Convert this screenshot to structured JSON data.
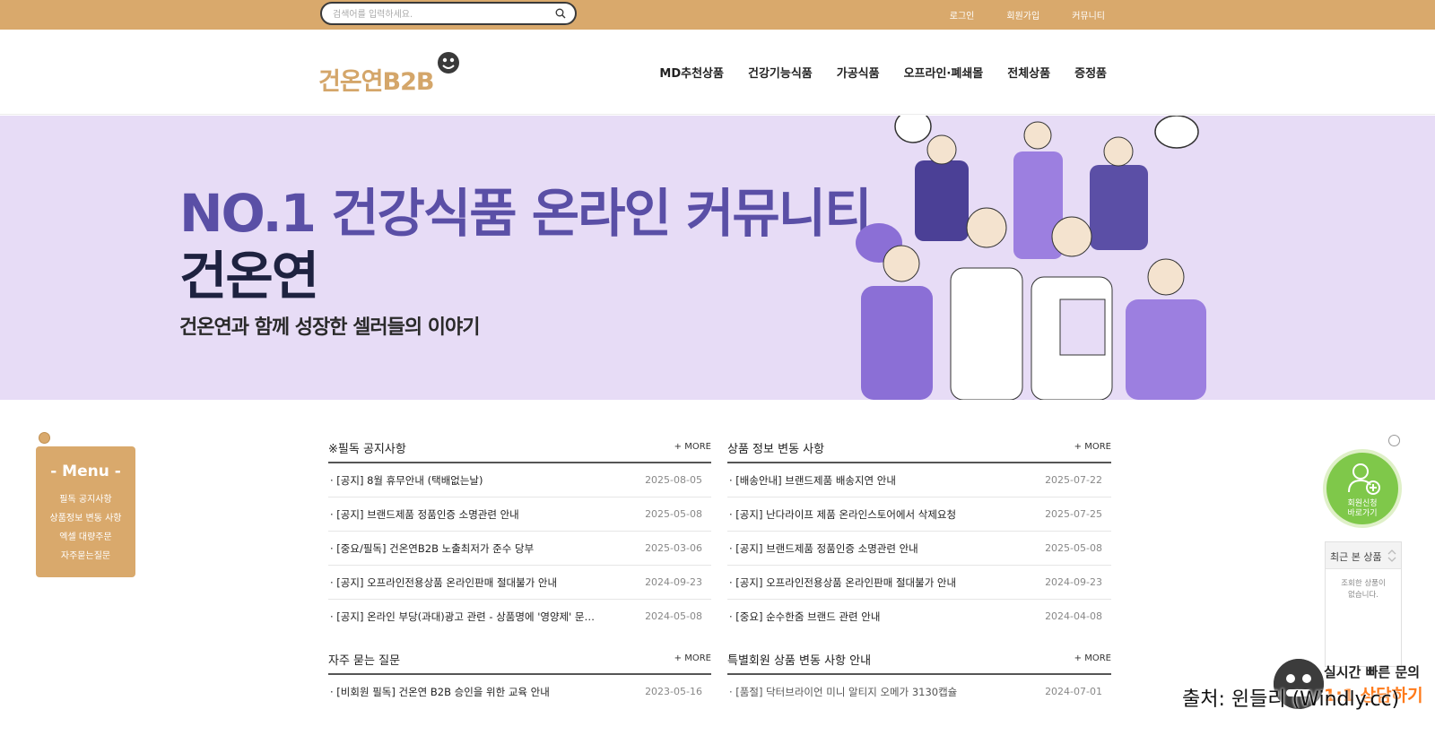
{
  "topbar": {
    "search_placeholder": "검색어를 입력하세요.",
    "links": [
      "로그인",
      "회원가입",
      "커뮤니티"
    ]
  },
  "header": {
    "logo_text": "건온연B2B",
    "nav": [
      "MD추천상품",
      "건강기능식품",
      "가공식품",
      "오프라인·폐쇄몰",
      "전체상품",
      "증정품"
    ]
  },
  "banner": {
    "title": "NO.1 건강식품 온라인 커뮤니티",
    "brand": "건온연",
    "subtitle": "건온연과 함께 성장한 셀러들의 이야기"
  },
  "float_menu": {
    "title": "- Menu -",
    "items": [
      "필독 공지사항",
      "상품정보 변동 사항",
      "엑셀 대량주문",
      "자주묻는질문"
    ]
  },
  "boards": {
    "notice": {
      "title": "※필독 공지사항",
      "more": "+ MORE",
      "rows": [
        {
          "title": "· [공지] 8월 휴무안내 (택배없는날)",
          "date": "2025-08-05"
        },
        {
          "title": "· [공지] 브랜드제품 정품인증 소명관련 안내",
          "date": "2025-05-08"
        },
        {
          "title": "· [중요/필독] 건온연B2B 노출최저가 준수 당부",
          "date": "2025-03-06"
        },
        {
          "title": "· [공지] 오프라인전용상품 온라인판매 절대불가 안내",
          "date": "2024-09-23"
        },
        {
          "title": "· [공지] 온라인 부당(과대)광고 관련 - 상품명에 '영양제' 문구…",
          "date": "2024-05-08"
        }
      ]
    },
    "product_change": {
      "title": "상품 정보 변동 사항",
      "more": "+ MORE",
      "rows": [
        {
          "title": "· [배송안내] 브랜드제품 배송지연 안내",
          "date": "2025-07-22"
        },
        {
          "title": "· [공지] 난다라이프 제품 온라인스토어에서 삭제요청",
          "date": "2025-07-25"
        },
        {
          "title": "· [공지] 브랜드제품 정품인증 소명관련 안내",
          "date": "2025-05-08"
        },
        {
          "title": "· [공지] 오프라인전용상품 온라인판매 절대불가 안내",
          "date": "2024-09-23"
        },
        {
          "title": "· [중요] 순수한줌 브랜드 관련 안내",
          "date": "2024-04-08"
        }
      ]
    },
    "faq": {
      "title": "자주 묻는 질문",
      "more": "+ MORE",
      "rows": [
        {
          "title": "· [비회원 필독] 건온연 B2B 승인을 위한 교육 안내",
          "date": "2023-05-16"
        }
      ]
    },
    "special": {
      "title": "특별회원 상품 변동 사항 안내",
      "more": "+ MORE",
      "rows": [
        {
          "title": "· [품절] 닥터브라이언 미니 알티지 오메가 3130캡슐",
          "date": "2024-07-01"
        }
      ]
    }
  },
  "widgets": {
    "signup_line1": "회원신청",
    "signup_line2": "바로가기",
    "recent_title": "최근 본 상품",
    "recent_empty_line1": "조회한 상품이",
    "recent_empty_line2": "없습니다.",
    "chat_line1": "실시간 빠른 문의",
    "chat_line2": "1:1 상담하기"
  },
  "source_caption": "출처: 윈들리 (Windly.cc)",
  "colors": {
    "topbar": "#d9a96c",
    "banner_bg": "#e7dcf6",
    "banner_accent": "#5a4fa6",
    "signup_green": "#7fc84a"
  }
}
